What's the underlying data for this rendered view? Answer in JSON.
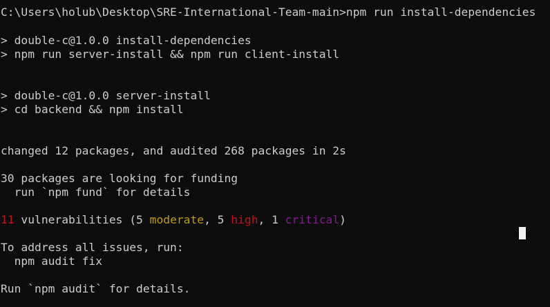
{
  "terminal": {
    "lines": {
      "l1": "C:\\Users\\holub\\Desktop\\SRE-International-Team-main>npm run install-dependencies",
      "l2": "> double-c@1.0.0 install-dependencies",
      "l3": "> npm run server-install && npm run client-install",
      "l4": "> double-c@1.0.0 server-install",
      "l5": "> cd backend && npm install",
      "l6": "changed 12 packages, and audited 268 packages in 2s",
      "l7": "30 packages are looking for funding",
      "l8": "  run `npm fund` for details",
      "l10": "To address all issues, run:",
      "l11": "  npm audit fix",
      "l12": "Run `npm audit` for details."
    },
    "vuln": {
      "count": "11",
      "text_a": " vulnerabilities (5 ",
      "moderate": "moderate",
      "text_b": ", 5 ",
      "high": "high",
      "text_c": ", 1 ",
      "critical": "critical",
      "text_d": ")"
    },
    "colors": {
      "background": "#0c0c0c",
      "foreground": "#cccccc",
      "moderate": "#c19c00",
      "high": "#c50f1f",
      "critical": "#881798",
      "cursor": "#f2f2f2"
    }
  }
}
